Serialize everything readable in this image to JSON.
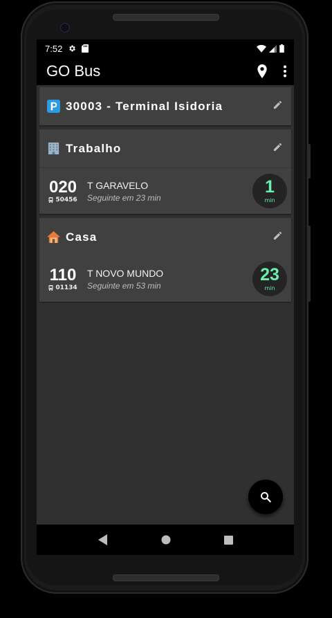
{
  "status_bar": {
    "time": "7:52"
  },
  "app_bar": {
    "title": "GO Bus"
  },
  "cards": [
    {
      "name": "30003 - Terminal Isidoria",
      "icon": "parking-icon",
      "routes": []
    },
    {
      "name": "Trabalho",
      "icon": "office-building-icon",
      "routes": [
        {
          "number": "020",
          "bus_id": "50456",
          "destination": "T GARAVELO",
          "next": "Seguinte em 23 min",
          "eta": "1",
          "eta_unit": "min"
        }
      ]
    },
    {
      "name": "Casa",
      "icon": "house-icon",
      "routes": [
        {
          "number": "110",
          "bus_id": "01134",
          "destination": "T NOVO MUNDO",
          "next": "Seguinte em 53 min",
          "eta": "23",
          "eta_unit": "min"
        }
      ]
    }
  ],
  "colors": {
    "accent": "#69f0ae",
    "card": "#404040",
    "background": "#303030",
    "bar": "#000000"
  }
}
